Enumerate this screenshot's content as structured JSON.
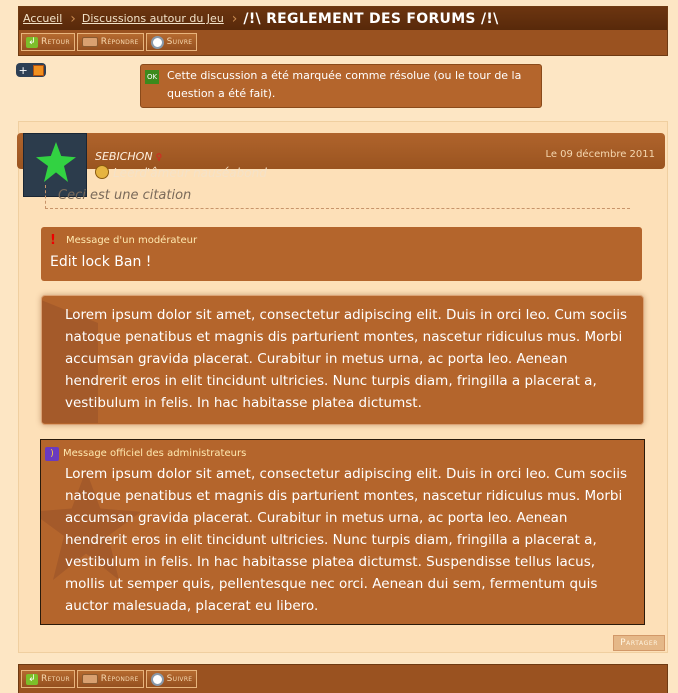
{
  "breadcrumb": {
    "home": "Accueil",
    "forum": "Discussions autour du Jeu",
    "title": "/!\\ REGLEMENT DES FORUMS /!\\"
  },
  "toolbar": {
    "back": "Retour",
    "reply": "Répondre",
    "follow": "Suivre"
  },
  "resolved_notice": "Cette discussion a été marquée comme résolue (ou le tour de la question a été fait).",
  "post": {
    "author": "SEBICHON",
    "user_title": "Leerd'âmeur nauséabond",
    "date": "Le 09 décembre 2011",
    "quote": "Ceci est une citation",
    "moderator_label": "Message d'un modérateur",
    "moderator_text": "Edit lock Ban !",
    "lorem_block": "Lorem ipsum dolor sit amet, consectetur adipiscing elit. Duis in orci leo. Cum sociis natoque penatibus et magnis dis parturient montes, nascetur ridiculus mus. Morbi accumsan gravida placerat. Curabitur in metus urna, ac porta leo. Aenean hendrerit eros in elit tincidunt ultricies. Nunc turpis diam, fringilla a placerat a, vestibulum in felis. In hac habitasse platea dictumst.",
    "admin_label": "Message officiel des administrateurs",
    "admin_text": "Lorem ipsum dolor sit amet, consectetur adipiscing elit. Duis in orci leo. Cum sociis natoque penatibus et magnis dis parturient montes, nascetur ridiculus mus. Morbi accumsan gravida placerat. Curabitur in metus urna, ac porta leo. Aenean hendrerit eros in elit tincidunt ultricies. Nunc turpis diam, fringilla a placerat a, vestibulum in felis. In hac habitasse platea dictumst. Suspendisse tellus lacus, mollis ut semper quis, pellentesque nec orci. Aenean dui sem, fermentum quis auctor malesuada, placerat eu libero.",
    "share": "Partager"
  },
  "add_button": "+",
  "colors": {
    "page_bg": "#fde6c4",
    "bar": "#9a5220",
    "panel": "#b4652c"
  }
}
